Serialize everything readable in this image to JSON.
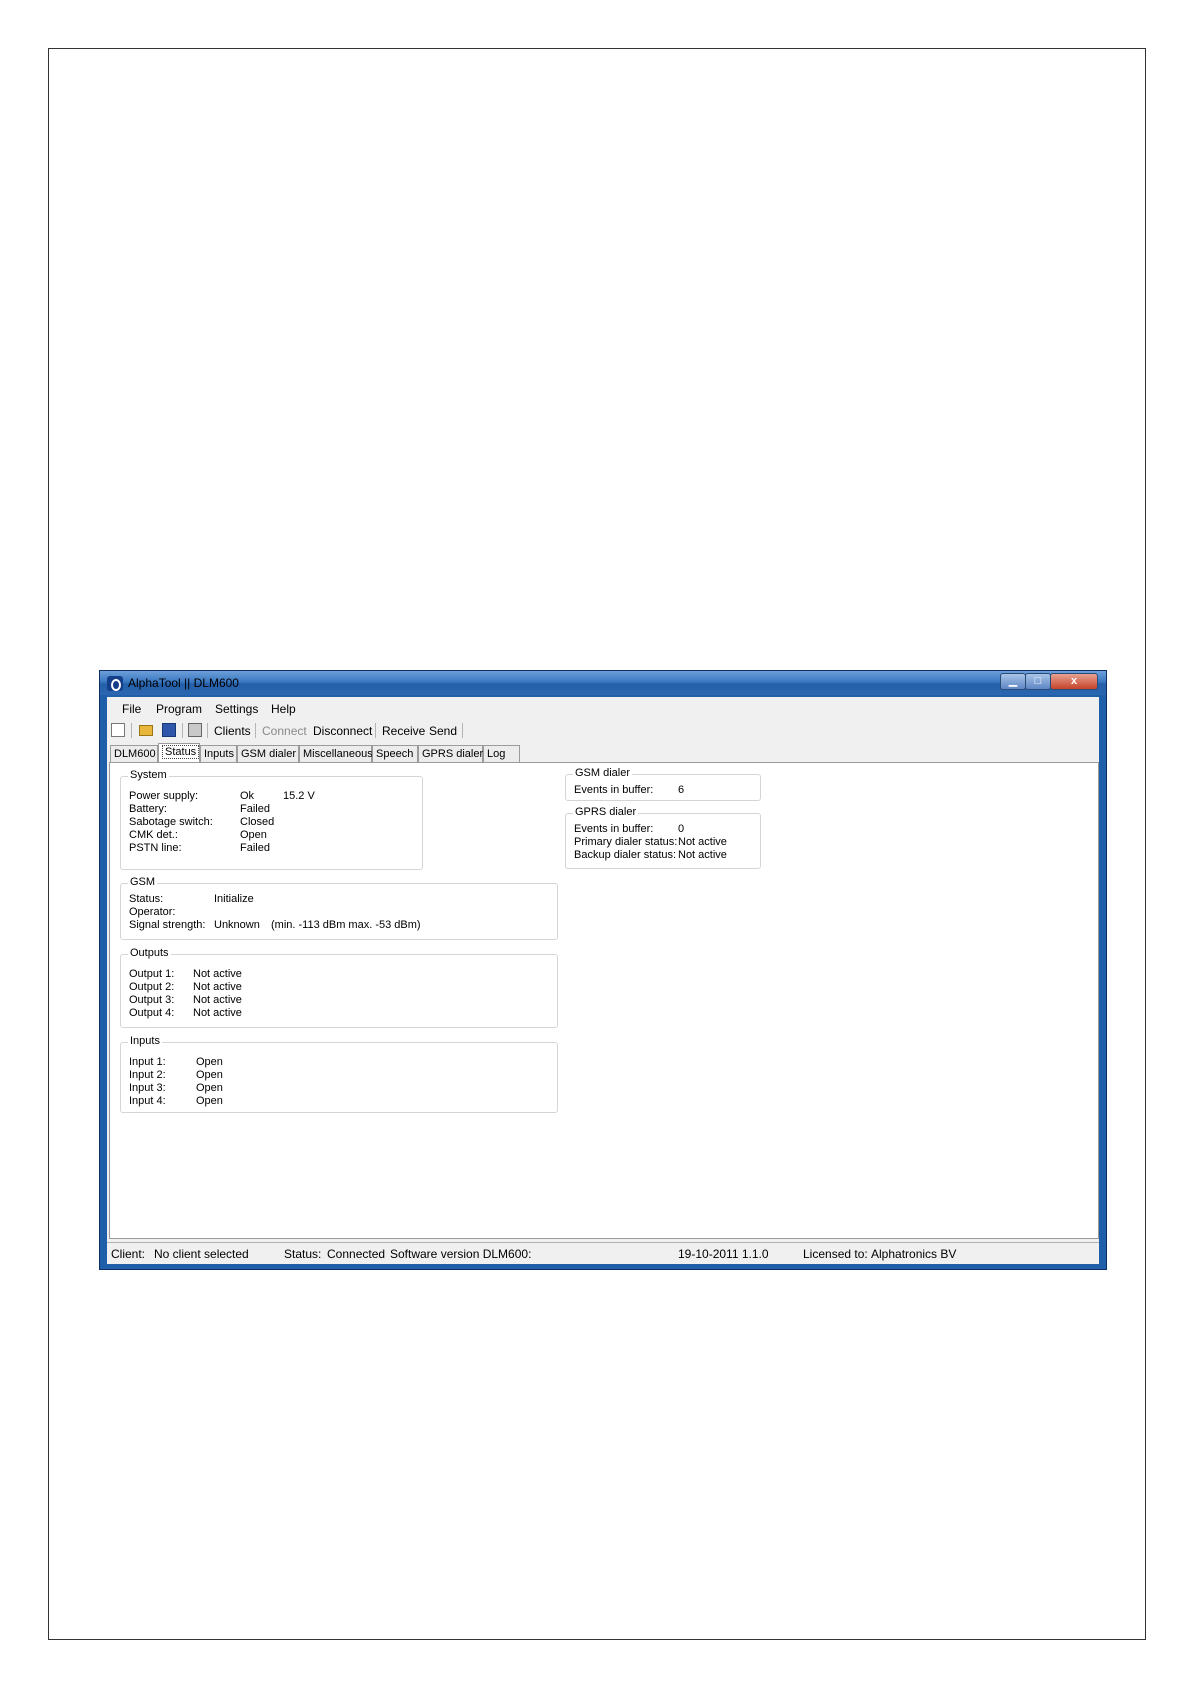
{
  "window": {
    "title": "AlphaTool || DLM600",
    "min_glyph": "▁",
    "max_glyph": "□",
    "close_glyph": "x"
  },
  "menu": {
    "file": "File",
    "program": "Program",
    "settings": "Settings",
    "help": "Help"
  },
  "toolbar": {
    "clients": "Clients",
    "connect": "Connect",
    "disconnect": "Disconnect",
    "receive": "Receive",
    "send": "Send"
  },
  "tabs": [
    "DLM600",
    "Status",
    "Inputs",
    "GSM dialer",
    "Miscellaneous",
    "Speech",
    "GPRS dialer",
    "Log"
  ],
  "active_tab": "Status",
  "system": {
    "title": "System",
    "rows": [
      {
        "label": "Power supply:",
        "value": "Ok",
        "extra": "15.2 V"
      },
      {
        "label": "Battery:",
        "value": "Failed"
      },
      {
        "label": "Sabotage switch:",
        "value": "Closed"
      },
      {
        "label": "CMK det.:",
        "value": "Open"
      },
      {
        "label": "PSTN line:",
        "value": "Failed"
      }
    ]
  },
  "gsm": {
    "title": "GSM",
    "status_label": "Status:",
    "status_value": "Initialize",
    "operator_label": "Operator:",
    "signal_label": "Signal strength:",
    "signal_value": "Unknown",
    "signal_range": "(min. -113 dBm max. -53 dBm)"
  },
  "outputs": {
    "title": "Outputs",
    "rows": [
      {
        "label": "Output 1:",
        "value": "Not active"
      },
      {
        "label": "Output 2:",
        "value": "Not active"
      },
      {
        "label": "Output 3:",
        "value": "Not active"
      },
      {
        "label": "Output 4:",
        "value": "Not active"
      }
    ]
  },
  "inputs": {
    "title": "Inputs",
    "rows": [
      {
        "label": "Input 1:",
        "value": "Open"
      },
      {
        "label": "Input 2:",
        "value": "Open"
      },
      {
        "label": "Input 3:",
        "value": "Open"
      },
      {
        "label": "Input 4:",
        "value": "Open"
      }
    ]
  },
  "gsm_dialer": {
    "title": "GSM dialer",
    "events_label": "Events in buffer:",
    "events_value": "6"
  },
  "gprs_dialer": {
    "title": "GPRS dialer",
    "events_label": "Events in buffer:",
    "events_value": "0",
    "primary_label": "Primary dialer status:",
    "primary_value": "Not active",
    "backup_label": "Backup dialer status:",
    "backup_value": "Not active"
  },
  "statusbar": {
    "client_label": "Client:",
    "client_value": "No client selected",
    "status_label": "Status:",
    "status_value": "Connected",
    "software_label": "Software version DLM600:",
    "software_value": "19-10-2011 1.1.0",
    "licensed_label": "Licensed to:",
    "licensed_value": "Alphatronics BV"
  }
}
